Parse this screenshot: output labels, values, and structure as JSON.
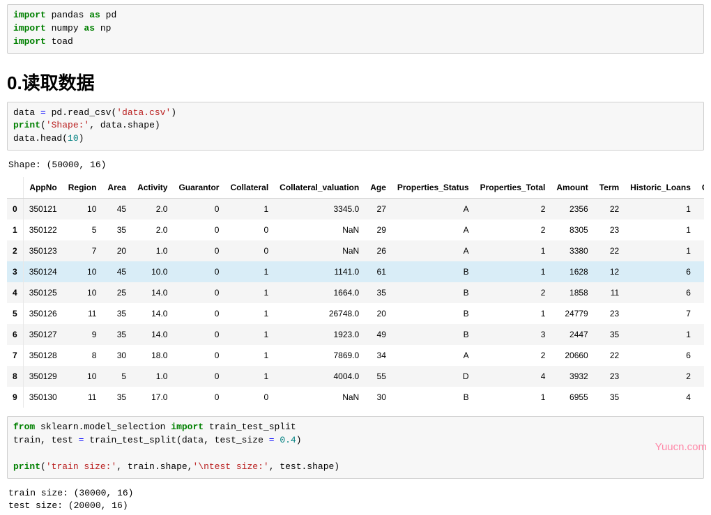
{
  "cell1": {
    "line1": {
      "kw1": "import",
      "mod": " pandas ",
      "kw2": "as",
      "alias": " pd"
    },
    "line2": {
      "kw1": "import",
      "mod": " numpy ",
      "kw2": "as",
      "alias": " np"
    },
    "line3": {
      "kw1": "import",
      "mod": " toad"
    }
  },
  "heading": "0.读取数据",
  "cell2": {
    "l1a": "data ",
    "l1b": "=",
    "l1c": " pd.read_csv(",
    "l1d": "'data.csv'",
    "l1e": ")",
    "l2a": "print",
    "l2b": "(",
    "l2c": "'Shape:'",
    "l2d": ", data.shape)",
    "l3a": "data.head(",
    "l3b": "10",
    "l3c": ")"
  },
  "out1": "Shape: (50000, 16)\n",
  "table": {
    "columns": [
      "AppNo",
      "Region",
      "Area",
      "Activity",
      "Guarantor",
      "Collateral",
      "Collateral_valuation",
      "Age",
      "Properties_Status",
      "Properties_Total",
      "Amount",
      "Term",
      "Historic_Loans",
      "Current_"
    ],
    "index": [
      "0",
      "1",
      "2",
      "3",
      "4",
      "5",
      "6",
      "7",
      "8",
      "9"
    ],
    "rows": [
      [
        "350121",
        "10",
        "45",
        "2.0",
        "0",
        "1",
        "3345.0",
        "27",
        "A",
        "2",
        "2356",
        "22",
        "1",
        ""
      ],
      [
        "350122",
        "5",
        "35",
        "2.0",
        "0",
        "0",
        "NaN",
        "29",
        "A",
        "2",
        "8305",
        "23",
        "1",
        ""
      ],
      [
        "350123",
        "7",
        "20",
        "1.0",
        "0",
        "0",
        "NaN",
        "26",
        "A",
        "1",
        "3380",
        "22",
        "1",
        ""
      ],
      [
        "350124",
        "10",
        "45",
        "10.0",
        "0",
        "1",
        "1141.0",
        "61",
        "B",
        "1",
        "1628",
        "12",
        "6",
        ""
      ],
      [
        "350125",
        "10",
        "25",
        "14.0",
        "0",
        "1",
        "1664.0",
        "35",
        "B",
        "2",
        "1858",
        "11",
        "6",
        ""
      ],
      [
        "350126",
        "11",
        "35",
        "14.0",
        "0",
        "1",
        "26748.0",
        "20",
        "B",
        "1",
        "24779",
        "23",
        "7",
        ""
      ],
      [
        "350127",
        "9",
        "35",
        "14.0",
        "0",
        "1",
        "1923.0",
        "49",
        "B",
        "3",
        "2447",
        "35",
        "1",
        ""
      ],
      [
        "350128",
        "8",
        "30",
        "18.0",
        "0",
        "1",
        "7869.0",
        "34",
        "A",
        "2",
        "20660",
        "22",
        "6",
        ""
      ],
      [
        "350129",
        "10",
        "5",
        "1.0",
        "0",
        "1",
        "4004.0",
        "55",
        "D",
        "4",
        "3932",
        "23",
        "2",
        ""
      ],
      [
        "350130",
        "11",
        "35",
        "17.0",
        "0",
        "0",
        "NaN",
        "30",
        "B",
        "1",
        "6955",
        "35",
        "4",
        ""
      ]
    ],
    "highlight_row": 3
  },
  "cell3": {
    "l1a": "from",
    "l1b": " sklearn.model_selection ",
    "l1c": "import",
    "l1d": " train_test_split",
    "l2a": "train, test ",
    "l2b": "=",
    "l2c": " train_test_split(data, test_size ",
    "l2d": "=",
    "l2e": " ",
    "l2f": "0.4",
    "l2g": ")",
    "l3a": "print",
    "l3b": "(",
    "l3c": "'train size:'",
    "l3d": ", train.shape,",
    "l3e": "'\\ntest size:'",
    "l3f": ", test.shape)"
  },
  "out2": "train size: (30000, 16)\ntest size: (20000, 16)",
  "watermark": "Yuucn.com"
}
